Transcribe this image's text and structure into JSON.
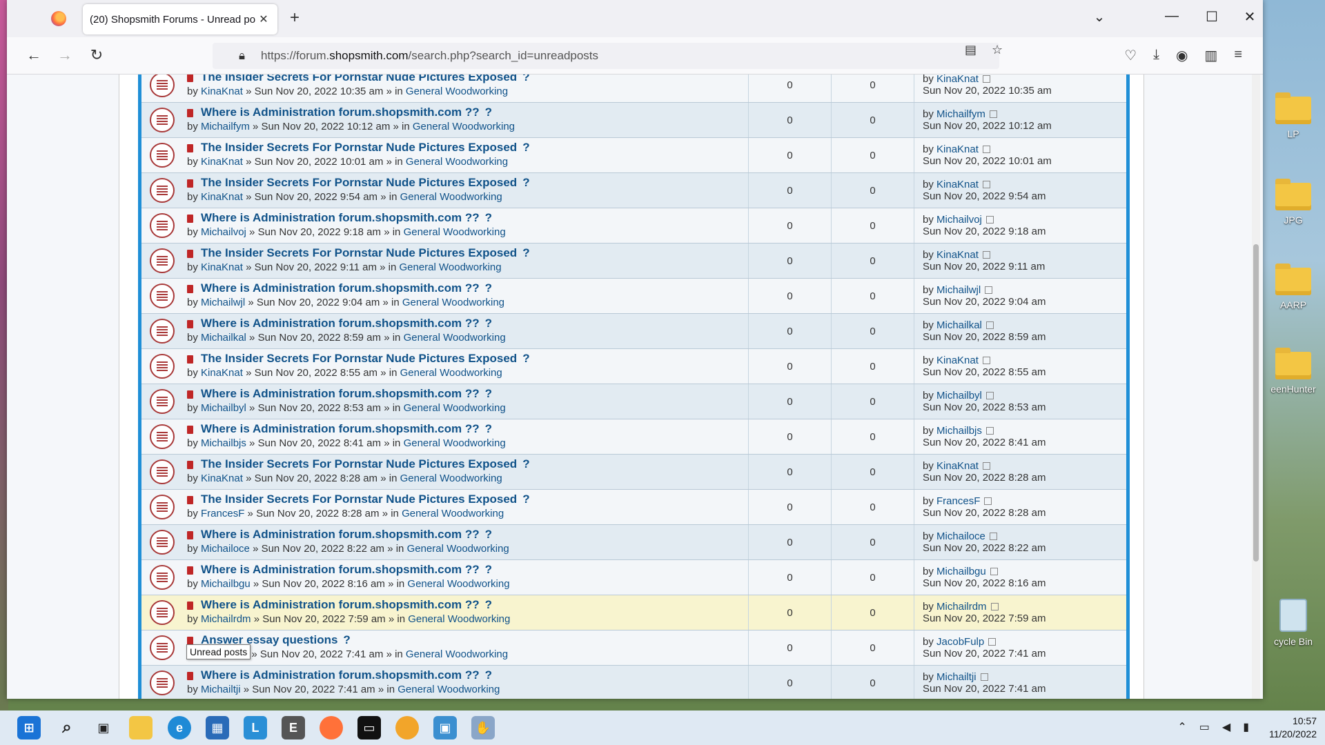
{
  "browser": {
    "tab_title": "(20) Shopsmith Forums - Unread po",
    "url_prefix": "https://forum.",
    "url_domain": "shopsmith.com",
    "url_suffix": "/search.php?search_id=unreadposts"
  },
  "desktop_icons": [
    "LP",
    "JPG",
    "AARP",
    "eenHunter",
    "cycle Bin"
  ],
  "tooltip": "Unread posts",
  "topics": [
    {
      "title": "The Insider Secrets For Pornstar Nude Pictures Exposed",
      "author": "KinaKnat",
      "date": "Sun Nov 20, 2022 10:35 am",
      "forum": "General Woodworking",
      "replies": "0",
      "views": "0",
      "last_by": "KinaKnat",
      "last_date": "Sun Nov 20, 2022 10:35 am"
    },
    {
      "title": "Where is Administration forum.shopsmith.com ??",
      "author": "Michailfym",
      "date": "Sun Nov 20, 2022 10:12 am",
      "forum": "General Woodworking",
      "replies": "0",
      "views": "0",
      "last_by": "Michailfym",
      "last_date": "Sun Nov 20, 2022 10:12 am"
    },
    {
      "title": "The Insider Secrets For Pornstar Nude Pictures Exposed",
      "author": "KinaKnat",
      "date": "Sun Nov 20, 2022 10:01 am",
      "forum": "General Woodworking",
      "replies": "0",
      "views": "0",
      "last_by": "KinaKnat",
      "last_date": "Sun Nov 20, 2022 10:01 am"
    },
    {
      "title": "The Insider Secrets For Pornstar Nude Pictures Exposed",
      "author": "KinaKnat",
      "date": "Sun Nov 20, 2022 9:54 am",
      "forum": "General Woodworking",
      "replies": "0",
      "views": "0",
      "last_by": "KinaKnat",
      "last_date": "Sun Nov 20, 2022 9:54 am"
    },
    {
      "title": "Where is Administration forum.shopsmith.com ??",
      "author": "Michailvoj",
      "date": "Sun Nov 20, 2022 9:18 am",
      "forum": "General Woodworking",
      "replies": "0",
      "views": "0",
      "last_by": "Michailvoj",
      "last_date": "Sun Nov 20, 2022 9:18 am"
    },
    {
      "title": "The Insider Secrets For Pornstar Nude Pictures Exposed",
      "author": "KinaKnat",
      "date": "Sun Nov 20, 2022 9:11 am",
      "forum": "General Woodworking",
      "replies": "0",
      "views": "0",
      "last_by": "KinaKnat",
      "last_date": "Sun Nov 20, 2022 9:11 am"
    },
    {
      "title": "Where is Administration forum.shopsmith.com ??",
      "author": "Michailwjl",
      "date": "Sun Nov 20, 2022 9:04 am",
      "forum": "General Woodworking",
      "replies": "0",
      "views": "0",
      "last_by": "Michailwjl",
      "last_date": "Sun Nov 20, 2022 9:04 am"
    },
    {
      "title": "Where is Administration forum.shopsmith.com ??",
      "author": "Michailkal",
      "date": "Sun Nov 20, 2022 8:59 am",
      "forum": "General Woodworking",
      "replies": "0",
      "views": "0",
      "last_by": "Michailkal",
      "last_date": "Sun Nov 20, 2022 8:59 am"
    },
    {
      "title": "The Insider Secrets For Pornstar Nude Pictures Exposed",
      "author": "KinaKnat",
      "date": "Sun Nov 20, 2022 8:55 am",
      "forum": "General Woodworking",
      "replies": "0",
      "views": "0",
      "last_by": "KinaKnat",
      "last_date": "Sun Nov 20, 2022 8:55 am"
    },
    {
      "title": "Where is Administration forum.shopsmith.com ??",
      "author": "Michailbyl",
      "date": "Sun Nov 20, 2022 8:53 am",
      "forum": "General Woodworking",
      "replies": "0",
      "views": "0",
      "last_by": "Michailbyl",
      "last_date": "Sun Nov 20, 2022 8:53 am"
    },
    {
      "title": "Where is Administration forum.shopsmith.com ??",
      "author": "Michailbjs",
      "date": "Sun Nov 20, 2022 8:41 am",
      "forum": "General Woodworking",
      "replies": "0",
      "views": "0",
      "last_by": "Michailbjs",
      "last_date": "Sun Nov 20, 2022 8:41 am"
    },
    {
      "title": "The Insider Secrets For Pornstar Nude Pictures Exposed",
      "author": "KinaKnat",
      "date": "Sun Nov 20, 2022 8:28 am",
      "forum": "General Woodworking",
      "replies": "0",
      "views": "0",
      "last_by": "KinaKnat",
      "last_date": "Sun Nov 20, 2022 8:28 am"
    },
    {
      "title": "The Insider Secrets For Pornstar Nude Pictures Exposed",
      "author": "FrancesF",
      "date": "Sun Nov 20, 2022 8:28 am",
      "forum": "General Woodworking",
      "replies": "0",
      "views": "0",
      "last_by": "FrancesF",
      "last_date": "Sun Nov 20, 2022 8:28 am"
    },
    {
      "title": "Where is Administration forum.shopsmith.com ??",
      "author": "Michailoce",
      "date": "Sun Nov 20, 2022 8:22 am",
      "forum": "General Woodworking",
      "replies": "0",
      "views": "0",
      "last_by": "Michailoce",
      "last_date": "Sun Nov 20, 2022 8:22 am"
    },
    {
      "title": "Where is Administration forum.shopsmith.com ??",
      "author": "Michailbgu",
      "date": "Sun Nov 20, 2022 8:16 am",
      "forum": "General Woodworking",
      "replies": "0",
      "views": "0",
      "last_by": "Michailbgu",
      "last_date": "Sun Nov 20, 2022 8:16 am"
    },
    {
      "title": "Where is Administration forum.shopsmith.com ??",
      "author": "Michailrdm",
      "date": "Sun Nov 20, 2022 7:59 am",
      "forum": "General Woodworking",
      "replies": "0",
      "views": "0",
      "last_by": "Michailrdm",
      "last_date": "Sun Nov 20, 2022 7:59 am",
      "highlight": true
    },
    {
      "title": "Answer essay questions",
      "author": "JacobFulp",
      "date": "Sun Nov 20, 2022 7:41 am",
      "forum": "General Woodworking",
      "replies": "0",
      "views": "0",
      "last_by": "JacobFulp",
      "last_date": "Sun Nov 20, 2022 7:41 am"
    },
    {
      "title": "Where is Administration forum.shopsmith.com ??",
      "author": "Michailtji",
      "date": "Sun Nov 20, 2022 7:41 am",
      "forum": "General Woodworking",
      "replies": "0",
      "views": "0",
      "last_by": "Michailtji",
      "last_date": "Sun Nov 20, 2022 7:41 am"
    }
  ],
  "labels": {
    "by": "by",
    "sep": "»",
    "in": "» in",
    "q": "?"
  },
  "taskbar": {
    "time": "10:57",
    "date": "11/20/2022"
  }
}
